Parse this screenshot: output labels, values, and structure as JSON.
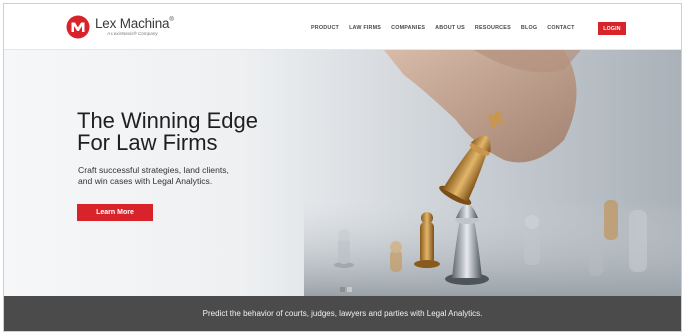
{
  "brand": {
    "name": "Lex Machina",
    "trademark": "®",
    "subtitle": "A LexisNexis® Company",
    "logo_letter": "M",
    "accent": "#d8232a"
  },
  "nav": {
    "items": [
      "PRODUCT",
      "LAW FIRMS",
      "COMPANIES",
      "ABOUT US",
      "RESOURCES",
      "BLOG",
      "CONTACT"
    ],
    "login_label": "LOGIN"
  },
  "hero": {
    "title_line1": "The Winning Edge",
    "title_line2": "For Law Firms",
    "sub_line1": "Craft successful strategies, land clients,",
    "sub_line2": "and win cases with Legal Analytics.",
    "cta_label": "Learn More",
    "slides": {
      "count": 2,
      "active": 1
    }
  },
  "banner": {
    "text": "Predict the behavior of courts, judges, lawyers and parties with Legal Analytics.",
    "bg": "#4b4b4b"
  }
}
